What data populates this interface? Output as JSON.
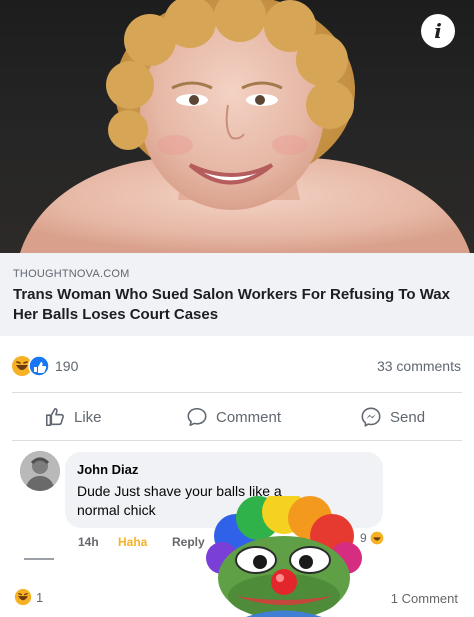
{
  "post": {
    "link": {
      "domain": "THOUGHTNOVA.COM",
      "title": "Trans Woman Who Sued Salon Workers For Refusing To Wax Her Balls Loses Court Cases"
    },
    "info_icon": "info-icon",
    "reactions": {
      "icons": [
        "haha-icon",
        "like-icon"
      ],
      "count": "190"
    },
    "comments_count": "33 comments",
    "actions": {
      "like": "Like",
      "comment": "Comment",
      "send": "Send"
    }
  },
  "comment": {
    "author": "John Diaz",
    "text": "Dude  Just shave your balls like a normal chick",
    "time": "14h",
    "reaction_label": "Haha",
    "reply": "Reply",
    "reaction_count": "9"
  },
  "footer": {
    "reaction_count": "1",
    "comments": "1 Comment"
  },
  "colors": {
    "background": "#ffffff",
    "link_box": "#f0f2f5",
    "secondary_text": "#606770",
    "haha_yellow": "#f7b125",
    "like_blue": "#1877f2"
  }
}
